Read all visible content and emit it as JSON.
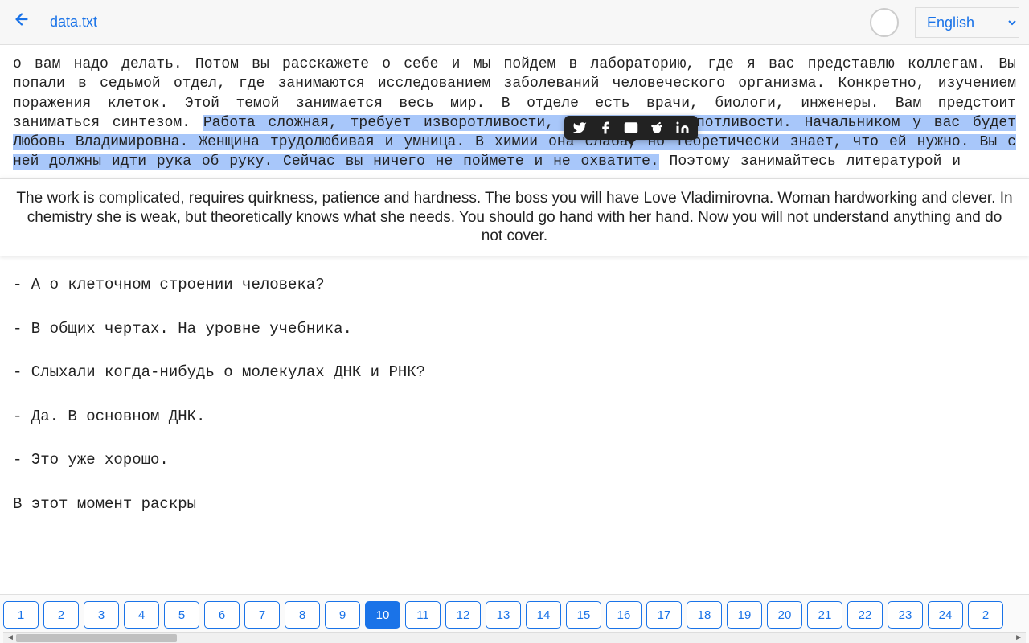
{
  "header": {
    "filename": "data.txt",
    "language": "English"
  },
  "paragraph": {
    "pre": "о вам надо делать. Потом вы расскажете о себе и мы пойдем в лабораторию, где я вас представлю коллегам. Вы попали в седьмой отдел, где занимаются исследованием заболеваний человеческого организма. Конкретно, изучением поражения клеток. Этой темой занимается весь мир. В отделе есть врачи, биологи, инженеры. Вам предстоит заниматься синтезом. ",
    "highlighted": "Работа сложная, требует изворотливости, терпения и кропотливости. Начальником у вас будет Любовь Владимировна. Женщина трудолюбивая и умница. В химии она слаба, но теоретически знает, что ей нужно. Вы с ней должны идти рука об руку. Сейчас вы ничего не поймете и не охватите.",
    "post": " Поэтому занимайтесь литературой и"
  },
  "translation": "The work is complicated, requires quirkness, patience and hardness. The boss you will have Love Vladimirovna. Woman hardworking and clever. In chemistry she is weak, but theoretically knows what she needs. You should go hand with her hand. Now you will not understand anything and do not cover.",
  "dialogue": [
    "- А о клеточном строении человека?",
    "- В общих чертах. На уровне учебника.",
    "- Слыхали когда-нибудь о молекулах ДНК и РНК?",
    "- Да. В основном ДНК.",
    "- Это уже хорошо.",
    "В этот момент раскры"
  ],
  "pages": [
    "1",
    "2",
    "3",
    "4",
    "5",
    "6",
    "7",
    "8",
    "9",
    "10",
    "11",
    "12",
    "13",
    "14",
    "15",
    "16",
    "17",
    "18",
    "19",
    "20",
    "21",
    "22",
    "23",
    "24",
    "2"
  ],
  "current_page": "10",
  "share_icons": [
    "twitter",
    "facebook",
    "email",
    "reddit",
    "linkedin"
  ]
}
